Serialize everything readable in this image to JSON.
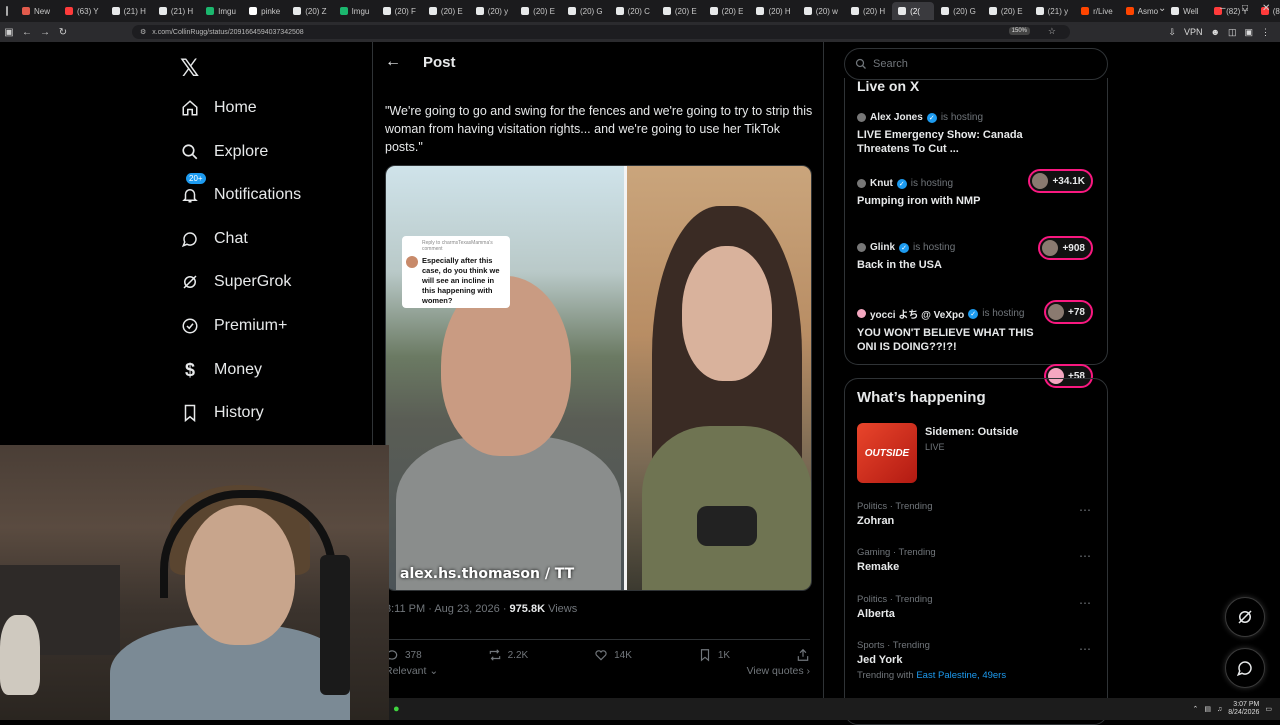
{
  "browser": {
    "tabs": [
      {
        "title": "New",
        "color": "#e25b4c"
      },
      {
        "title": "(63) Y",
        "color": "#ff3b3b"
      },
      {
        "title": "(21) H",
        "color": "#e7e9ea"
      },
      {
        "title": "(21) H",
        "color": "#e7e9ea"
      },
      {
        "title": "Imgu",
        "color": "#1bb76e"
      },
      {
        "title": "pinke",
        "color": "#ffffff"
      },
      {
        "title": "(20) Z",
        "color": "#e7e9ea"
      },
      {
        "title": "Imgu",
        "color": "#1bb76e"
      },
      {
        "title": "(20) F",
        "color": "#e7e9ea"
      },
      {
        "title": "(20) E",
        "color": "#e7e9ea"
      },
      {
        "title": "(20) y",
        "color": "#e7e9ea"
      },
      {
        "title": "(20) E",
        "color": "#e7e9ea"
      },
      {
        "title": "(20) G",
        "color": "#e7e9ea"
      },
      {
        "title": "(20) C",
        "color": "#e7e9ea"
      },
      {
        "title": "(20) E",
        "color": "#e7e9ea"
      },
      {
        "title": "(20) E",
        "color": "#e7e9ea"
      },
      {
        "title": "(20) H",
        "color": "#e7e9ea"
      },
      {
        "title": "(20) w",
        "color": "#e7e9ea"
      },
      {
        "title": "(20) H",
        "color": "#e7e9ea"
      },
      {
        "title": "(2(",
        "color": "#e7e9ea"
      },
      {
        "title": "(20) G",
        "color": "#e7e9ea"
      },
      {
        "title": "(20) E",
        "color": "#e7e9ea"
      },
      {
        "title": "(21) y",
        "color": "#e7e9ea"
      },
      {
        "title": "r/Live",
        "color": "#ff4500"
      },
      {
        "title": "Asmo",
        "color": "#ff4500"
      },
      {
        "title": "Well",
        "color": "#e7e9ea"
      },
      {
        "title": "(82) Y",
        "color": "#ff3b3b"
      },
      {
        "title": "(82) Y",
        "color": "#ff3b3b"
      },
      {
        "title": "(82",
        "color": "#ff3b3b"
      }
    ],
    "active_tab_index": 19,
    "url": "x.com/CollinRugg/status/2091664594037342508",
    "zoom": "150%",
    "vpn": "VPN"
  },
  "nav": {
    "items": [
      {
        "label": "Home",
        "icon": "home-icon"
      },
      {
        "label": "Explore",
        "icon": "search-icon"
      },
      {
        "label": "Notifications",
        "icon": "bell-icon",
        "badge": "20+"
      },
      {
        "label": "Chat",
        "icon": "chat-bubble-icon"
      },
      {
        "label": "SuperGrok",
        "icon": "grok-icon"
      },
      {
        "label": "Premium+",
        "icon": "premium-check-icon"
      },
      {
        "label": "Money",
        "icon": "dollar-icon"
      },
      {
        "label": "History",
        "icon": "bookmark-icon"
      }
    ]
  },
  "post": {
    "header": "Post",
    "text": "\"We're going to go and swing for the fences and we're going to try to strip this woman from having visitation rights... and we're going to use her TikTok posts.\"",
    "media": {
      "reply_meta": "Reply to charmsTexasMamma's comment",
      "reply_text": "Especially after this case, do you think we will see an incline in this happening with women?",
      "watermark": "alex.hs.thomason / TT"
    },
    "timestamp": "3:11 PM · Aug 23, 2026 · ",
    "views_count": "975.8K",
    "views_label": "Views",
    "actions": {
      "replies": "378",
      "reposts": "2.2K",
      "likes": "14K",
      "bookmarks": "1K"
    },
    "relevant": "Relevant",
    "view_quotes": "View quotes"
  },
  "right": {
    "search_placeholder": "Search",
    "live_title": "Live on X",
    "live": [
      {
        "host": "Alex Jones",
        "hosting": "is hosting",
        "title": "LIVE Emergency Show: Canada Threatens To Cut ...",
        "count": "+34.1K"
      },
      {
        "host": "Knut",
        "hosting": "is hosting",
        "title": "Pumping iron with NMP",
        "count": "+908"
      },
      {
        "host": "Glink",
        "hosting": "is hosting",
        "title": "Back in the USA",
        "count": "+78"
      },
      {
        "host": "yocci よち @ VeXpo",
        "hosting": "is hosting",
        "title": "YOU WON'T BELIEVE WHAT THIS ONI IS DOING??!?!",
        "count": "+58"
      }
    ],
    "happening_title": "What’s happening",
    "event": {
      "thumb": "OUTSIDE",
      "name": "Sidemen: Outside",
      "status": "LIVE"
    },
    "trends": [
      {
        "category": "Politics · Trending",
        "name": "Zohran"
      },
      {
        "category": "Gaming · Trending",
        "name": "Remake"
      },
      {
        "category": "Politics · Trending",
        "name": "Alberta"
      },
      {
        "category": "Sports · Trending",
        "name": "Jed York",
        "with_label": "Trending with",
        "with_links": "East Palestine, 49ers"
      }
    ]
  },
  "taskbar": {
    "time": "3:07 PM",
    "date": "8/24/2026"
  },
  "colors": {
    "accent": "#1d9bf0",
    "live_ring": "#f91880",
    "background": "#000000",
    "border": "#2f3336"
  }
}
